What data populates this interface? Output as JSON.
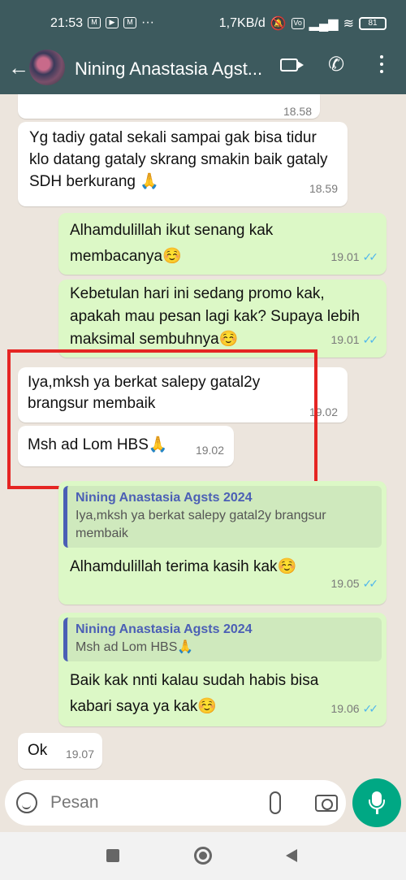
{
  "status_bar": {
    "time": "21:53",
    "network_speed": "1,7KB/d",
    "battery": "81",
    "icons": [
      "gmail-icon",
      "youtube-icon",
      "gmail-icon",
      "more-dots-icon",
      "mute-icon",
      "volte-icon",
      "signal-icon",
      "wifi-icon",
      "battery-icon"
    ]
  },
  "header": {
    "contact_name": "Nining Anastasia Agst..."
  },
  "messages": [
    {
      "id": "m0",
      "direction": "in",
      "text": "",
      "time": "18.58"
    },
    {
      "id": "m1",
      "direction": "in",
      "text": "Yg tadiy gatal sekali sampai gak bisa tidur klo datang gataly skrang smakin baik gataly SDH berkurang 🙏",
      "time": "18.59"
    },
    {
      "id": "m2",
      "direction": "out",
      "text": "Alhamdulillah ikut senang kak membacanya☺️",
      "time": "19.01",
      "ticks": "✓✓"
    },
    {
      "id": "m3",
      "direction": "out",
      "text": "Kebetulan hari ini sedang promo kak, apakah mau pesan lagi kak? Supaya lebih maksimal sembuhnya☺️",
      "time": "19.01",
      "ticks": "✓✓"
    },
    {
      "id": "m4",
      "direction": "in",
      "text": "Iya,mksh ya berkat salepy gatal2y brangsur membaik",
      "time": "19.02"
    },
    {
      "id": "m5",
      "direction": "in",
      "text": "Msh ad Lom HBS🙏",
      "time": "19.02"
    },
    {
      "id": "m6",
      "direction": "out",
      "quote_name": "Nining Anastasia Agsts 2024",
      "quote_text": "Iya,mksh ya berkat salepy gatal2y brangsur membaik",
      "text": "Alhamdulillah terima kasih kak☺️",
      "time": "19.05",
      "ticks": "✓✓"
    },
    {
      "id": "m7",
      "direction": "out",
      "quote_name": "Nining Anastasia Agsts 2024",
      "quote_text": "Msh ad Lom HBS🙏",
      "text": "Baik kak nnti kalau sudah habis bisa kabari saya ya kak☺️",
      "time": "19.06",
      "ticks": "✓✓"
    },
    {
      "id": "m8",
      "direction": "in",
      "text": "Ok",
      "time": "19.07"
    }
  ],
  "input": {
    "placeholder": "Pesan"
  },
  "colors": {
    "header": "#3d5a5e",
    "outgoing": "#dcf8c6",
    "incoming": "#ffffff",
    "highlight_box": "#e52523",
    "mic_button": "#00a884"
  }
}
